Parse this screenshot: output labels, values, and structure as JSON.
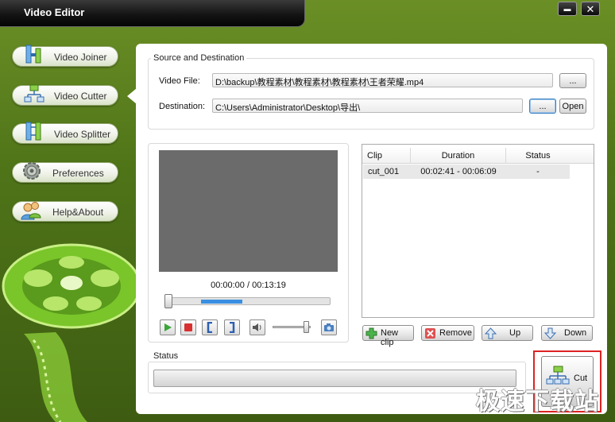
{
  "window": {
    "title": "Video Editor",
    "minimize_glyph": "▬",
    "close_glyph": "✕"
  },
  "nav": {
    "items": [
      {
        "label": "Video Joiner",
        "icon": "video-joiner-icon"
      },
      {
        "label": "Video Cutter",
        "icon": "video-cutter-icon",
        "active": true
      },
      {
        "label": "Video Splitter",
        "icon": "video-splitter-icon"
      },
      {
        "label": "Preferences",
        "icon": "gear-icon"
      },
      {
        "label": "Help&About",
        "icon": "users-icon"
      }
    ]
  },
  "source": {
    "group_title": "Source and Destination",
    "video_file_label": "Video File:",
    "video_file_value": "D:\\backup\\教程素材\\教程素材\\教程素材\\王者荣耀.mp4",
    "browse_label": "...",
    "destination_label": "Destination:",
    "destination_value": "C:\\Users\\Administrator\\Desktop\\导出\\",
    "dest_browse_label": "...",
    "open_label": "Open"
  },
  "player": {
    "timecode": "00:00:00 / 00:13:19"
  },
  "clips": {
    "columns": [
      "Clip",
      "Duration",
      "Status"
    ],
    "rows": [
      {
        "clip": "cut_001",
        "duration": "00:02:41 - 00:06:09",
        "status": "-"
      }
    ],
    "new_clip_label": "New clip",
    "remove_label": "Remove",
    "up_label": "Up",
    "down_label": "Down"
  },
  "status": {
    "group_title": "Status",
    "cut_label": "Cut"
  },
  "watermark": "极速下载站",
  "colors": {
    "accent_green": "#5f8a1e",
    "selection_blue": "#3a8fe0",
    "highlight_red": "#d22222"
  }
}
